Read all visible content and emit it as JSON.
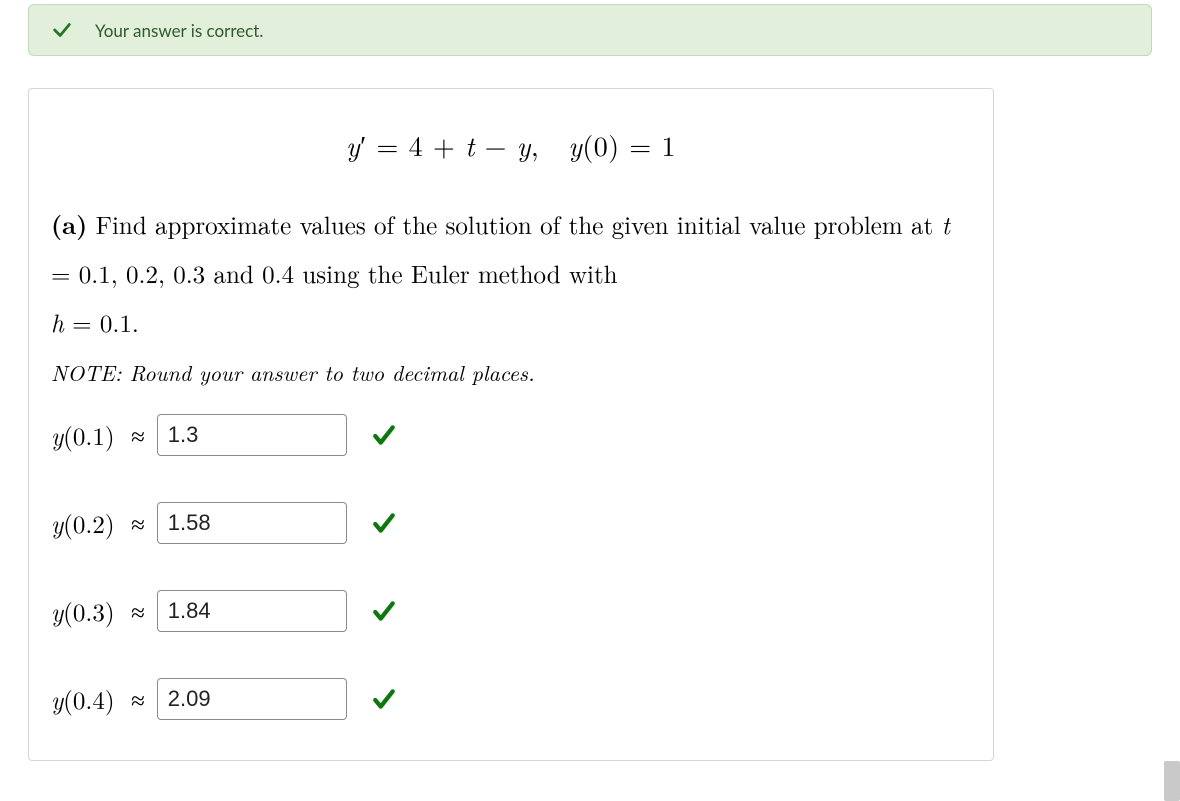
{
  "feedback": {
    "message": "Your answer is correct."
  },
  "equation": "y′ = 4 + t − y,  y(0) = 1",
  "prompt": {
    "part_label": "(a)",
    "text_before_t": "Find approximate values of the solution of the given initial value problem at ",
    "t_var": "t",
    "t_eq": " = 0.1, 0.2, 0.3 and 0.4 using the Euler method with",
    "h_var": "h",
    "h_eq": " = 0.1."
  },
  "note": "NOTE: Round your answer to two decimal places.",
  "answers": [
    {
      "label_var": "y",
      "label_arg": "(0.1)",
      "value": "1.3",
      "correct": true
    },
    {
      "label_var": "y",
      "label_arg": "(0.2)",
      "value": "1.58",
      "correct": true
    },
    {
      "label_var": "y",
      "label_arg": "(0.3)",
      "value": "1.84",
      "correct": true
    },
    {
      "label_var": "y",
      "label_arg": "(0.4)",
      "value": "2.09",
      "correct": true
    }
  ]
}
